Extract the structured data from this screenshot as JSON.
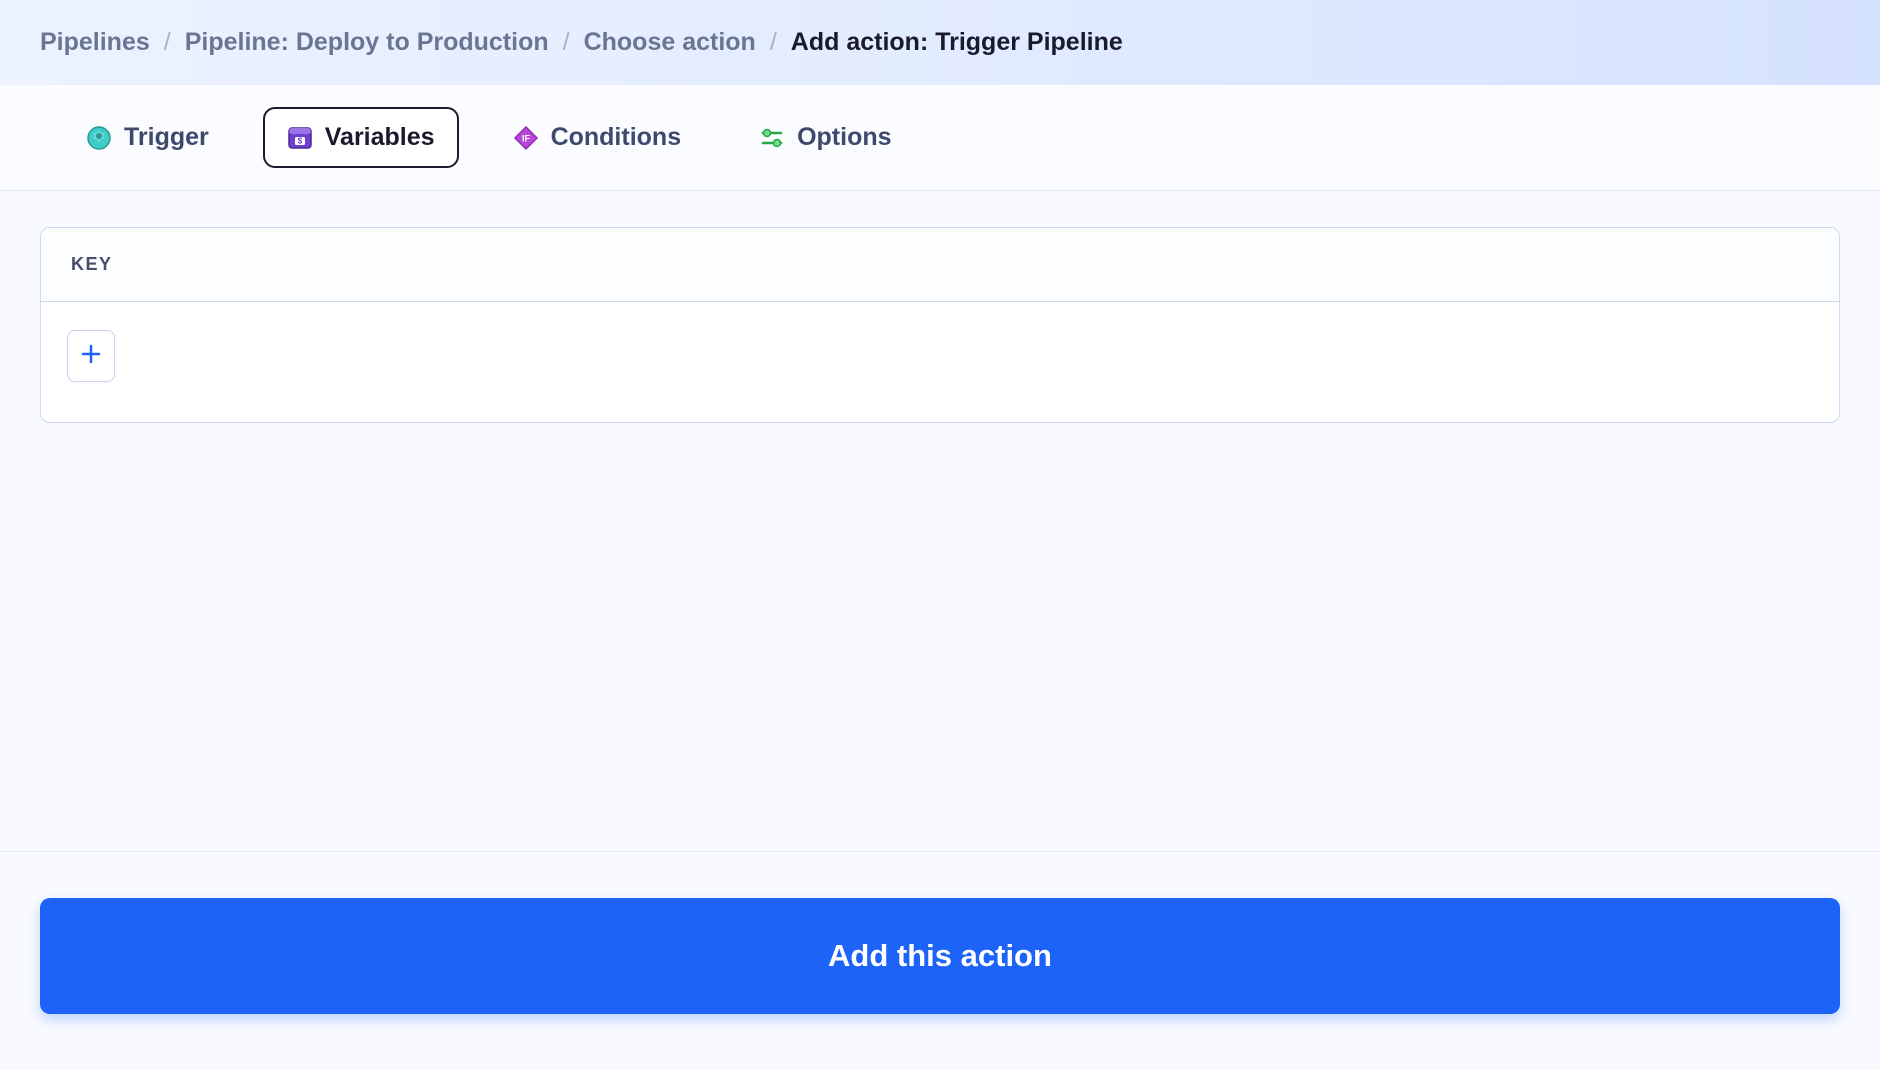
{
  "breadcrumb": {
    "items": [
      {
        "label": "Pipelines"
      },
      {
        "label": "Pipeline: Deploy to Production"
      },
      {
        "label": "Choose action"
      }
    ],
    "current": "Add action: Trigger Pipeline"
  },
  "tabs": [
    {
      "label": "Trigger",
      "icon": "gear-badge-icon"
    },
    {
      "label": "Variables",
      "icon": "variables-box-icon",
      "active": true
    },
    {
      "label": "Conditions",
      "icon": "if-diamond-icon"
    },
    {
      "label": "Options",
      "icon": "sliders-icon"
    }
  ],
  "panel": {
    "header": "KEY"
  },
  "footer": {
    "primary_button_label": "Add this action"
  }
}
